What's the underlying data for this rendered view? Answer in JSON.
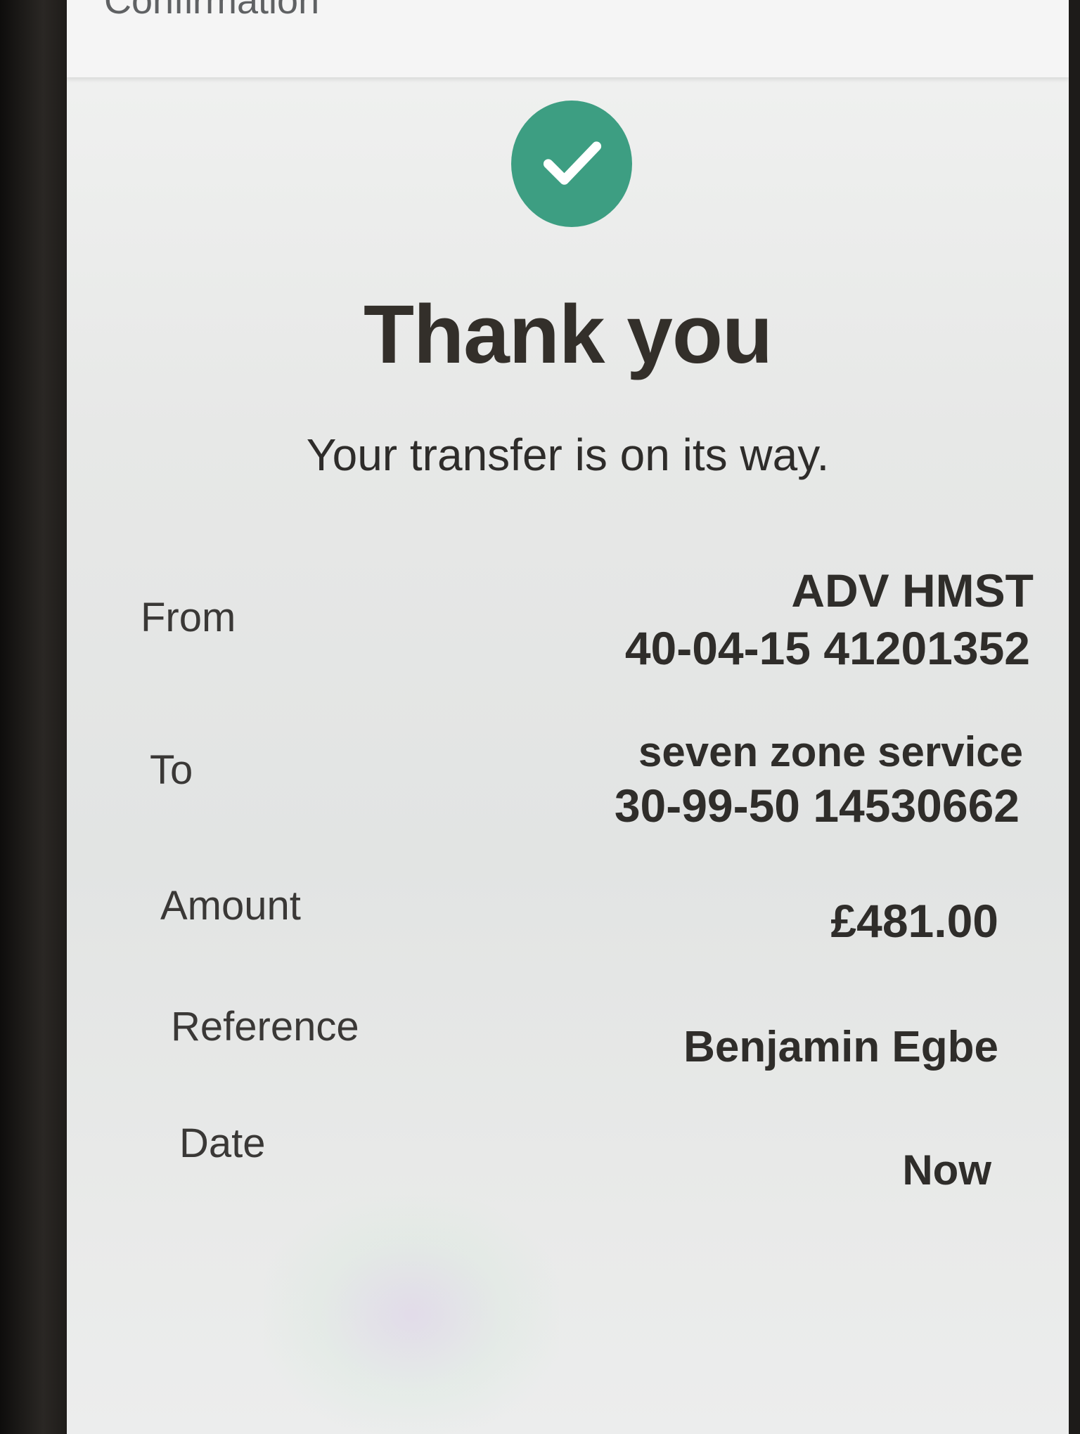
{
  "header": {
    "title": "Confirmation"
  },
  "status": {
    "icon": "check-circle-icon",
    "accent_color": "#3d9e82"
  },
  "headline": "Thank you",
  "subtitle": "Your transfer is on its way.",
  "details": {
    "from": {
      "label": "From",
      "name": "ADV HMST",
      "account": "40-04-15 41201352"
    },
    "to": {
      "label": "To",
      "name": "seven zone service",
      "account": "30-99-50 14530662"
    },
    "amount": {
      "label": "Amount",
      "value": "£481.00"
    },
    "reference": {
      "label": "Reference",
      "value": "Benjamin Egbe"
    },
    "date": {
      "label": "Date",
      "value": "Now"
    }
  }
}
